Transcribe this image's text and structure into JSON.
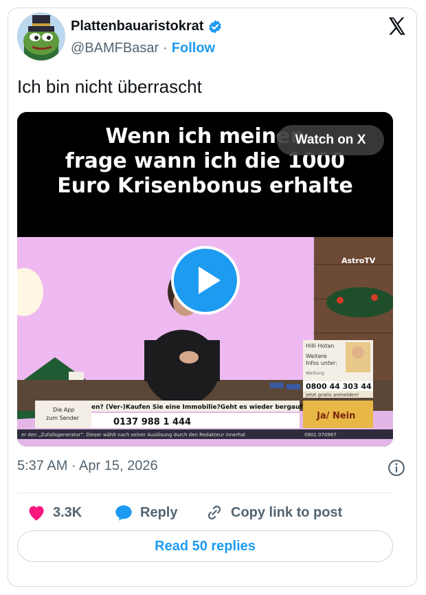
{
  "author": {
    "display_name": "Plattenbauaristokrat",
    "handle": "@BAMFBasar",
    "separator": "·",
    "follow_label": "Follow",
    "verified_color": "#1d9bf0"
  },
  "tweet": {
    "text": "Ich bin nicht überrascht",
    "timestamp": "5:37 AM · Apr 15, 2026"
  },
  "media": {
    "caption_lines": [
      "Wenn ich meinen",
      "frage wann ich die 1000",
      "Euro Krisenbonus erhalte"
    ],
    "watch_label": "Watch on X",
    "tv": {
      "channel_logo": "AstroTV",
      "presenter_name": "Hilli Hotan",
      "info_line1": "Weitere",
      "info_line2": "Infos unter:",
      "ad_label": "Werbung",
      "phone_main": "0800 44 303 44",
      "register": "jetzt gratis anmelden!",
      "app_line1": "Die App",
      "app_line2": "zum Sender",
      "ticker_question": "en? (Ver-)Kaufen Sie eine Immobilie?Geht es wieder bergauf? V",
      "phone_number": "0137 988 1 444",
      "ja_nein": "Ja/ Nein",
      "bottom_ticker": "er den „Zufallsgenerator\". Dieser wählt nach seiner Auslösung durch den Redakteur innerhal",
      "bottom_phone": "0901 070987"
    }
  },
  "actions": {
    "likes": "3.3K",
    "reply_label": "Reply",
    "copy_label": "Copy link to post",
    "read_replies": "Read 50 replies"
  },
  "colors": {
    "accent": "#1d9bf0",
    "heart": "#f91880",
    "secondary_text": "#536471"
  }
}
